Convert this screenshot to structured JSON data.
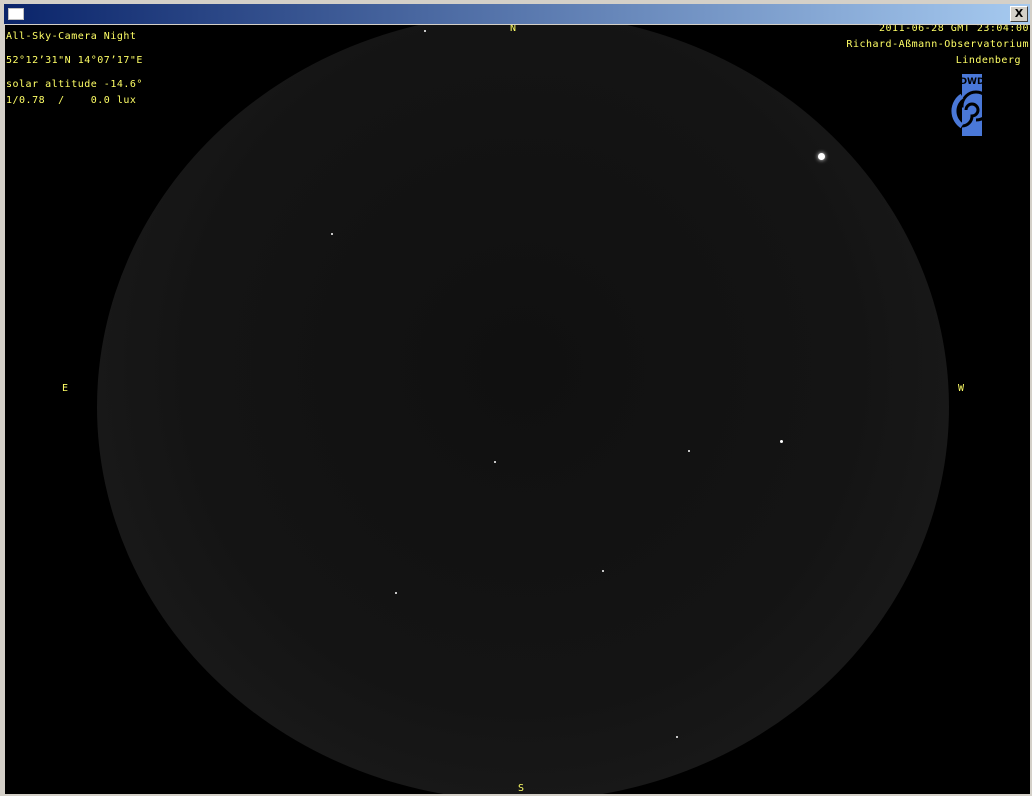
{
  "window": {
    "close_label": "X"
  },
  "overlay": {
    "title": "All-Sky-Camera Night",
    "coordinates": "52°12’31\"N 14°07’17\"E",
    "solar_altitude": "solar altitude -14.6°",
    "exposure": "1/0.78  /    0.0 lux",
    "datetime": "2011-06-28 GMT 23:04:00",
    "observatory": "Richard-Aßmann-Observatorium",
    "location": "Lindenberg"
  },
  "compass": {
    "north": "N",
    "south": "S",
    "east": "E",
    "west": "W"
  },
  "logo": {
    "text": "DWD",
    "color": "#4a78d8"
  },
  "colors": {
    "text": "#ffff66",
    "sky": "#000000"
  }
}
